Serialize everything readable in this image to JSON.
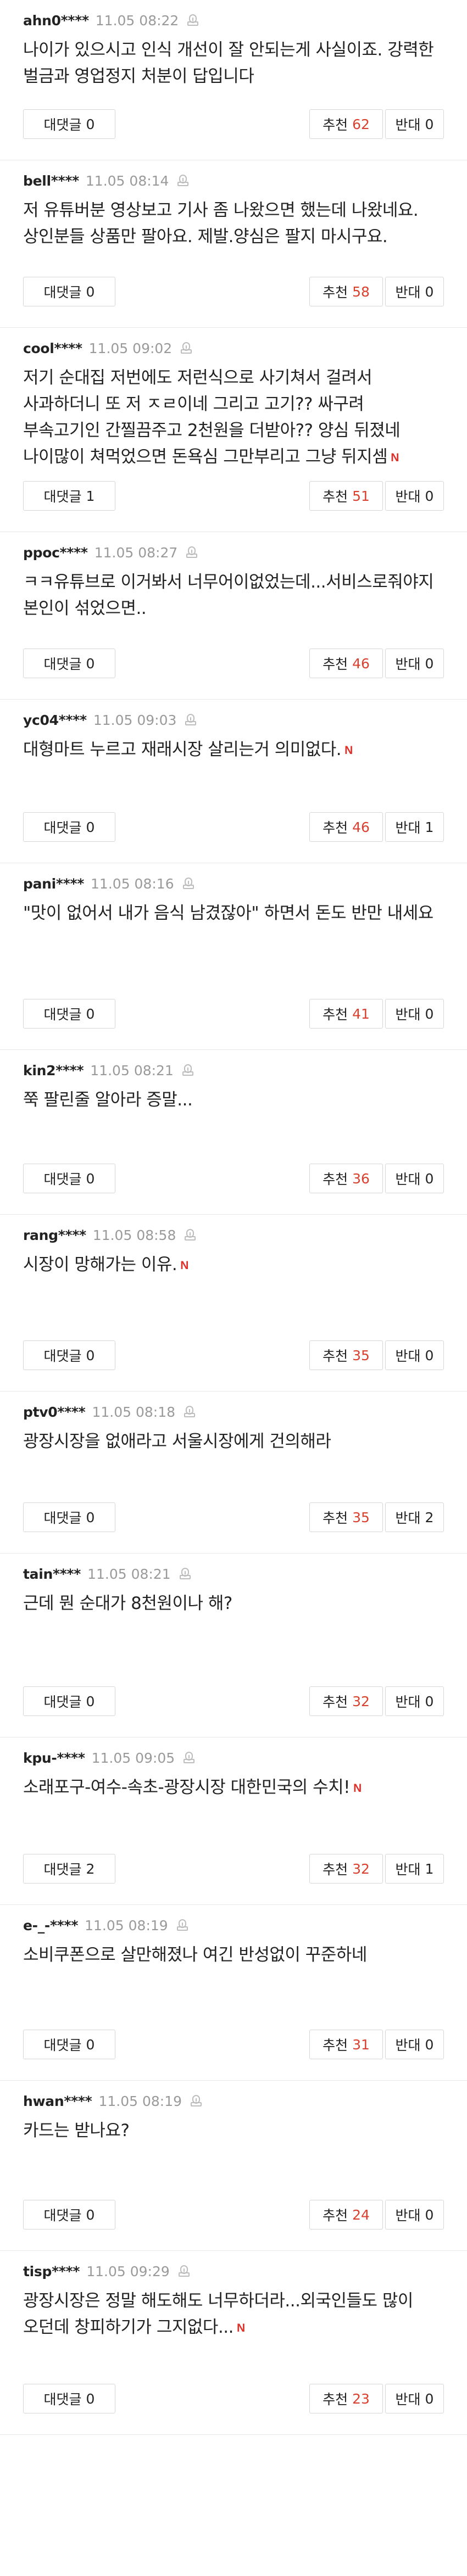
{
  "labels": {
    "reply": "대댓글",
    "like": "추천",
    "dislike": "반대",
    "badge_new": "N"
  },
  "comments": [
    {
      "author": "ahn0****",
      "date": "11.05 08:22",
      "text": "나이가 있으시고 인식 개선이 잘 안되는게 사실이죠. 강력한 벌금과 영업정지 처분이 답입니다",
      "is_new": false,
      "replies": "0",
      "likes": "62",
      "dislikes": "0"
    },
    {
      "author": "bell****",
      "date": "11.05 08:14",
      "text": "저 유튜버분 영상보고 기사 좀 나왔으면 했는데 나왔네요.상인분들 상품만 팔아요. 제발.양심은 팔지 마시구요.",
      "is_new": false,
      "replies": "0",
      "likes": "58",
      "dislikes": "0"
    },
    {
      "author": "cool****",
      "date": "11.05 09:02",
      "text": "저기 순대집 저번에도 저런식으로 사기쳐서 걸려서 사과하더니 또 저 ㅈㄹ이네 그리고 고기?? 싸구려 부속고기인 간찔끔주고 2천원을 더받아?? 양심 뒤졌네 나이많이 쳐먹었으면 돈욕심 그만부리고 그냥 뒤지셈",
      "is_new": true,
      "replies": "1",
      "likes": "51",
      "dislikes": "0"
    },
    {
      "author": "ppoc****",
      "date": "11.05 08:27",
      "text": "ㅋㅋ유튜브로 이거봐서 너무어이없었는데...서비스로줘야지 본인이 섞었으면..",
      "is_new": false,
      "replies": "0",
      "likes": "46",
      "dislikes": "0"
    },
    {
      "author": "yc04****",
      "date": "11.05 09:03",
      "text": "대형마트 누르고 재래시장 살리는거 의미없다.",
      "is_new": true,
      "replies": "0",
      "likes": "46",
      "dislikes": "1"
    },
    {
      "author": "pani****",
      "date": "11.05 08:16",
      "text": "\"맛이 없어서 내가 음식 남겼잖아\" 하면서 돈도 반만 내세요",
      "is_new": false,
      "replies": "0",
      "likes": "41",
      "dislikes": "0"
    },
    {
      "author": "kin2****",
      "date": "11.05 08:21",
      "text": "쭉 팔린줄 알아라 증말...",
      "is_new": false,
      "replies": "0",
      "likes": "36",
      "dislikes": "0"
    },
    {
      "author": "rang****",
      "date": "11.05 08:58",
      "text": "시장이 망해가는 이유.",
      "is_new": true,
      "replies": "0",
      "likes": "35",
      "dislikes": "0"
    },
    {
      "author": "ptv0****",
      "date": "11.05 08:18",
      "text": "광장시장을 없애라고 서울시장에게 건의해라",
      "is_new": false,
      "replies": "0",
      "likes": "35",
      "dislikes": "2"
    },
    {
      "author": "tain****",
      "date": "11.05 08:21",
      "text": "근데 뭔 순대가 8천원이나 해?",
      "is_new": false,
      "replies": "0",
      "likes": "32",
      "dislikes": "0"
    },
    {
      "author": "kpu-****",
      "date": "11.05 09:05",
      "text": "소래포구-여수-속초-광장시장 대한민국의 수치!",
      "is_new": true,
      "replies": "2",
      "likes": "32",
      "dislikes": "1"
    },
    {
      "author": "e-_-****",
      "date": "11.05 08:19",
      "text": "소비쿠폰으로 살만해졌나 여긴 반성없이 꾸준하네",
      "is_new": false,
      "replies": "0",
      "likes": "31",
      "dislikes": "0"
    },
    {
      "author": "hwan****",
      "date": "11.05 08:19",
      "text": "카드는 받나요?",
      "is_new": false,
      "replies": "0",
      "likes": "24",
      "dislikes": "0"
    },
    {
      "author": "tisp****",
      "date": "11.05 09:29",
      "text": "광장시장은 정말 해도해도 너무하더라...외국인들도 많이 오던데 창피하기가 그지없다...",
      "is_new": true,
      "replies": "0",
      "likes": "23",
      "dislikes": "0"
    }
  ]
}
